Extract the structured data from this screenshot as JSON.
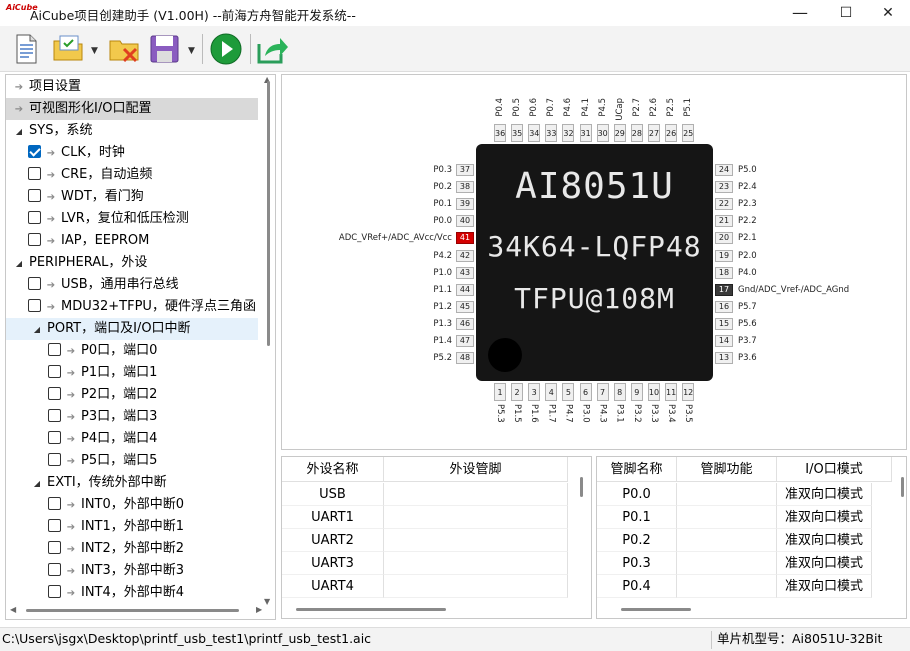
{
  "window": {
    "logo": "AiCube",
    "title": "AiCube项目创建助手 (V1.00H) --前海方舟智能开发系统--",
    "minimize": "—",
    "maximize": "☐",
    "close": "✕"
  },
  "toolbar": {
    "icons": [
      "new-document-icon",
      "open-project-icon",
      "close-project-icon",
      "save-icon",
      "run-icon",
      "export-icon"
    ]
  },
  "tree": {
    "items": [
      {
        "label": "项目设置"
      },
      {
        "label": "可视图形化I/O口配置"
      },
      {
        "label": "SYS，系统"
      },
      {
        "label": "CLK，时钟",
        "checked": true
      },
      {
        "label": "CRE，自动追频",
        "checked": false
      },
      {
        "label": "WDT，看门狗",
        "checked": false
      },
      {
        "label": "LVR，复位和低压检测",
        "checked": false
      },
      {
        "label": "IAP，EEPROM",
        "checked": false
      },
      {
        "label": "PERIPHERAL，外设"
      },
      {
        "label": "USB，通用串行总线",
        "checked": false
      },
      {
        "label": "MDU32+TFPU，硬件浮点三角函",
        "checked": false
      },
      {
        "label": "PORT，端口及I/O口中断"
      },
      {
        "label": "P0口，端口0",
        "checked": false
      },
      {
        "label": "P1口，端口1",
        "checked": false
      },
      {
        "label": "P2口，端口2",
        "checked": false
      },
      {
        "label": "P3口，端口3",
        "checked": false
      },
      {
        "label": "P4口，端口4",
        "checked": false
      },
      {
        "label": "P5口，端口5",
        "checked": false
      },
      {
        "label": "EXTI，传统外部中断"
      },
      {
        "label": "INT0，外部中断0",
        "checked": false
      },
      {
        "label": "INT1，外部中断1",
        "checked": false
      },
      {
        "label": "INT2，外部中断2",
        "checked": false
      },
      {
        "label": "INT3，外部中断3",
        "checked": false
      },
      {
        "label": "INT4，外部中断4",
        "checked": false
      }
    ]
  },
  "chip": {
    "line1": "AI8051U",
    "line2": "34K64-LQFP48",
    "line3": "TFPU@108M",
    "top_pins": [
      {
        "num": "36",
        "name": "P0.4"
      },
      {
        "num": "35",
        "name": "P0.5"
      },
      {
        "num": "34",
        "name": "P0.6"
      },
      {
        "num": "33",
        "name": "P0.7"
      },
      {
        "num": "32",
        "name": "P4.6"
      },
      {
        "num": "31",
        "name": "P4.1"
      },
      {
        "num": "30",
        "name": "P4.5"
      },
      {
        "num": "29",
        "name": "UCap"
      },
      {
        "num": "28",
        "name": "P2.7"
      },
      {
        "num": "27",
        "name": "P2.6"
      },
      {
        "num": "26",
        "name": "P2.5"
      },
      {
        "num": "25",
        "name": "P5.1"
      }
    ],
    "left_pins": [
      {
        "num": "37",
        "name": "P0.3"
      },
      {
        "num": "38",
        "name": "P0.2"
      },
      {
        "num": "39",
        "name": "P0.1"
      },
      {
        "num": "40",
        "name": "P0.0"
      },
      {
        "num": "41",
        "name": "ADC_VRef+/ADC_AVcc/Vcc"
      },
      {
        "num": "42",
        "name": "P4.2"
      },
      {
        "num": "43",
        "name": "P1.0"
      },
      {
        "num": "44",
        "name": "P1.1"
      },
      {
        "num": "45",
        "name": "P1.2"
      },
      {
        "num": "46",
        "name": "P1.3"
      },
      {
        "num": "47",
        "name": "P1.4"
      },
      {
        "num": "48",
        "name": "P5.2"
      }
    ],
    "right_pins": [
      {
        "num": "24",
        "name": "P5.0"
      },
      {
        "num": "23",
        "name": "P2.4"
      },
      {
        "num": "22",
        "name": "P2.3"
      },
      {
        "num": "21",
        "name": "P2.2"
      },
      {
        "num": "20",
        "name": "P2.1"
      },
      {
        "num": "19",
        "name": "P2.0"
      },
      {
        "num": "18",
        "name": "P4.0"
      },
      {
        "num": "17",
        "name": "Gnd/ADC_Vref-/ADC_AGnd"
      },
      {
        "num": "16",
        "name": "P5.7"
      },
      {
        "num": "15",
        "name": "P5.6"
      },
      {
        "num": "14",
        "name": "P3.7"
      },
      {
        "num": "13",
        "name": "P3.6"
      }
    ],
    "bottom_pins": [
      {
        "num": "1",
        "name": "P5.3"
      },
      {
        "num": "2",
        "name": "P1.5"
      },
      {
        "num": "3",
        "name": "P1.6"
      },
      {
        "num": "4",
        "name": "P1.7"
      },
      {
        "num": "5",
        "name": "P4.7"
      },
      {
        "num": "6",
        "name": "P3.0"
      },
      {
        "num": "7",
        "name": "P4.3"
      },
      {
        "num": "8",
        "name": "P3.1"
      },
      {
        "num": "9",
        "name": "P3.2"
      },
      {
        "num": "10",
        "name": "P3.3"
      },
      {
        "num": "11",
        "name": "P3.4"
      },
      {
        "num": "12",
        "name": "P3.5"
      }
    ],
    "colors": {
      "power": "#d40000",
      "ground": "#3a3a3a"
    }
  },
  "periph_table": {
    "headers": [
      "外设名称",
      "外设管脚"
    ],
    "rows": [
      [
        "USB",
        ""
      ],
      [
        "UART1",
        ""
      ],
      [
        "UART2",
        ""
      ],
      [
        "UART3",
        ""
      ],
      [
        "UART4",
        ""
      ]
    ]
  },
  "pin_table": {
    "headers": [
      "管脚名称",
      "管脚功能",
      "I/O口模式"
    ],
    "rows": [
      [
        "P0.0",
        "",
        "准双向口模式"
      ],
      [
        "P0.1",
        "",
        "准双向口模式"
      ],
      [
        "P0.2",
        "",
        "准双向口模式"
      ],
      [
        "P0.3",
        "",
        "准双向口模式"
      ],
      [
        "P0.4",
        "",
        "准双向口模式"
      ]
    ]
  },
  "status": {
    "path": "C:\\Users\\jsgx\\Desktop\\printf_usb_test1\\printf_usb_test1.aic",
    "chip_model": "单片机型号：Ai8051U-32Bit"
  }
}
